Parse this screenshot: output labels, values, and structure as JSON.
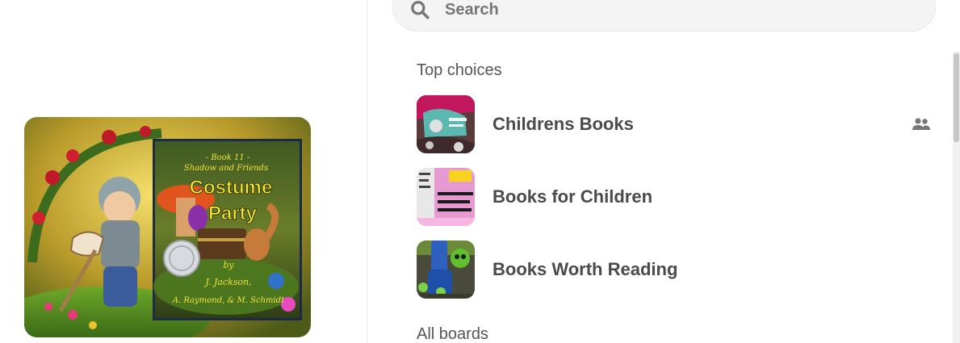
{
  "pin_preview": {
    "cover": {
      "series": "- Book 11 -",
      "subtitle": "Shadow and Friends",
      "title_line1": "Costume",
      "title_line2": "Party",
      "by": "by",
      "author_line1": "J. Jackson,",
      "author_line2": "A. Raymond, & M. Schmidt"
    }
  },
  "search": {
    "placeholder": "Search",
    "icon": "search-icon"
  },
  "sections": {
    "top_choices_label": "Top choices",
    "all_boards_label": "All boards"
  },
  "boards": [
    {
      "name": "Childrens Books",
      "collaborative": true,
      "icon": "group-icon"
    },
    {
      "name": "Books for Children",
      "collaborative": false
    },
    {
      "name": "Books Worth Reading",
      "collaborative": false
    }
  ],
  "colors": {
    "search_bg": "#f4f4f4",
    "text_primary": "#4a4a4a",
    "text_secondary": "#555555",
    "icon_gray": "#767676"
  }
}
